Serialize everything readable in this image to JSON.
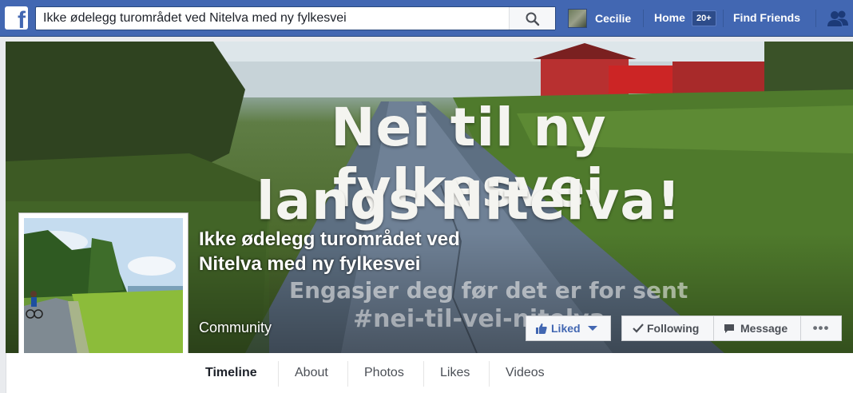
{
  "search": {
    "value": "Ikke ødelegg turområdet ved Nitelva med ny fylkesvei"
  },
  "nav": {
    "user_name": "Cecilie",
    "home_label": "Home",
    "home_badge": "20+",
    "find_friends_label": "Find Friends"
  },
  "cover": {
    "line1": "Nei til ny fylkesvei",
    "line2": "langs Nitelva!",
    "line3": "Engasjer deg før det er for sent",
    "line4": "#nei-til-vei-nitelva"
  },
  "page": {
    "name": "Ikke ødelegg turområdet ved Nitelva med ny fylkesvei",
    "category": "Community"
  },
  "actions": {
    "liked_label": "Liked",
    "following_label": "Following",
    "message_label": "Message",
    "more_label": "•••"
  },
  "tabs": [
    {
      "label": "Timeline"
    },
    {
      "label": "About"
    },
    {
      "label": "Photos"
    },
    {
      "label": "Likes"
    },
    {
      "label": "Videos"
    }
  ],
  "colors": {
    "brand": "#4267b2",
    "topbar_border": "#29487d"
  },
  "icons": [
    "facebook-logo-icon",
    "search-icon",
    "friend-requests-icon",
    "like-thumb-icon",
    "caret-down-icon",
    "checkmark-icon",
    "message-icon"
  ]
}
